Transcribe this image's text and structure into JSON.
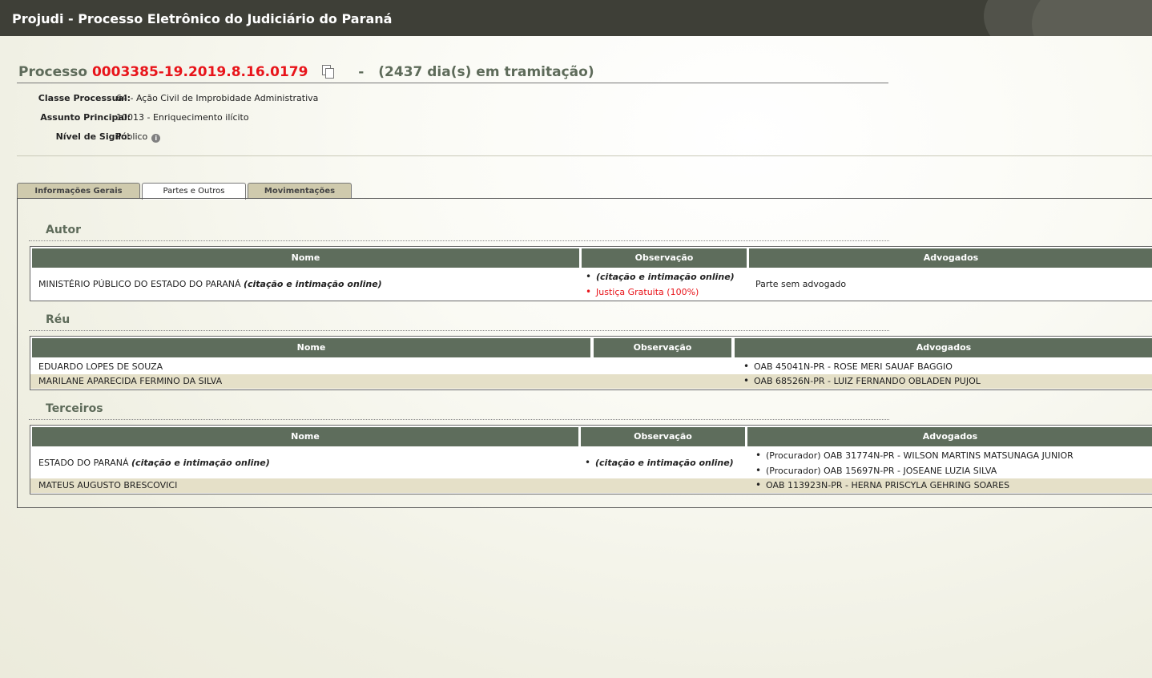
{
  "app": {
    "title": "Projudi - Processo Eletrônico do Judiciário do Paraná"
  },
  "process": {
    "label": "Processo",
    "number": "0003385-19.2019.8.16.0179",
    "dash": "-",
    "days": "(2437 dia(s) em tramitação)",
    "copy_icon": "copy-icon"
  },
  "info": {
    "classe_label": "Classe Processual:",
    "classe_value": "64 - Ação Civil de Improbidade Administrativa",
    "assunto_label": "Assunto Principal:",
    "assunto_value": "10013 - Enriquecimento ilícito",
    "sigilo_label": "Nível de Sigilo:",
    "sigilo_value": "Público",
    "info_icon": "info-icon"
  },
  "tabs": [
    {
      "label": "Informações Gerais"
    },
    {
      "label": "Partes e Outros"
    },
    {
      "label": "Movimentações"
    }
  ],
  "columns": {
    "nome": "Nome",
    "obs": "Observação",
    "adv": "Advogados"
  },
  "autor": {
    "title": "Autor",
    "rows": [
      {
        "nome": "MINISTÉRIO PÚBLICO DO ESTADO DO PARANÁ",
        "nome_tag": "(citação e intimação online)",
        "obs": [
          "(citação e intimação online)",
          "Justiça Gratuita (100%)"
        ],
        "adv": "Parte sem advogado"
      }
    ]
  },
  "reu": {
    "title": "Réu",
    "rows": [
      {
        "nome": "EDUARDO LOPES DE SOUZA",
        "adv": "OAB 45041N-PR - ROSE MERI SAUAF BAGGIO"
      },
      {
        "nome": "MARILANE APARECIDA FERMINO DA SILVA",
        "adv": "OAB 68526N-PR - LUIZ FERNANDO OBLADEN PUJOL"
      }
    ]
  },
  "terceiros": {
    "title": "Terceiros",
    "rows": [
      {
        "nome": "ESTADO DO PARANÁ",
        "nome_tag": "(citação e intimação online)",
        "obs": "(citação e intimação online)",
        "adv": [
          "(Procurador) OAB 31774N-PR - WILSON MARTINS MATSUNAGA JUNIOR",
          "(Procurador) OAB 15697N-PR - JOSEANE LUZIA SILVA"
        ]
      },
      {
        "nome": "MATEUS AUGUSTO BRESCOVICI",
        "adv": "OAB 113923N-PR - HERNA PRISCYLA GEHRING SOARES"
      }
    ]
  },
  "colors": {
    "header_bg": "#3e3f37",
    "accent_red": "#e8141a",
    "table_header": "#5e6d5c",
    "alt_row": "#e5e0c8",
    "tab_bg": "#cfcaad"
  }
}
